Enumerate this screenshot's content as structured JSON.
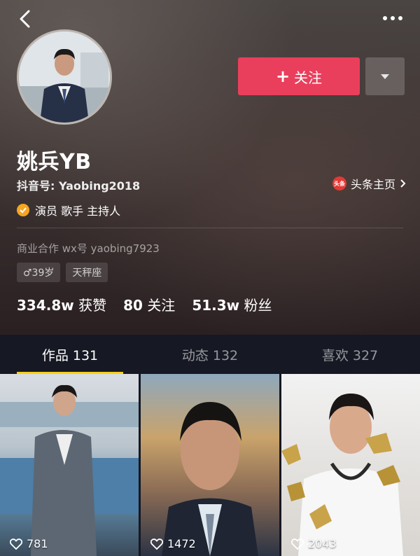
{
  "profile": {
    "name": "姚兵YB",
    "douyin_id": "抖音号: Yaobing2018",
    "toutiao_link": "头条主页",
    "toutiao_logo": "头条",
    "verified": "演员 歌手 主持人",
    "business": "商业合作 wx号 yaobing7923",
    "tags": [
      "♂39岁",
      "天秤座"
    ]
  },
  "actions": {
    "follow_label": "关注",
    "follow_plus": "+"
  },
  "stats": {
    "likes_num": "334.8w",
    "likes_label": "获赞",
    "following_num": "80",
    "following_label": "关注",
    "fans_num": "51.3w",
    "fans_label": "粉丝"
  },
  "tabs": [
    {
      "label": "作品 131",
      "active": true
    },
    {
      "label": "动态 132",
      "active": false
    },
    {
      "label": "喜欢 327",
      "active": false
    }
  ],
  "videos": [
    {
      "likes": "781"
    },
    {
      "likes": "1472"
    },
    {
      "likes": "2043"
    }
  ],
  "colors": {
    "accent": "#ea3f5c",
    "tab_indicator": "#face15",
    "verified": "#f5a623"
  },
  "icons": {
    "back": "chevron-left-icon",
    "more": "more-dots-icon",
    "dropdown": "caret-down-icon",
    "verified": "check-badge-icon",
    "heart": "heart-outline-icon"
  }
}
